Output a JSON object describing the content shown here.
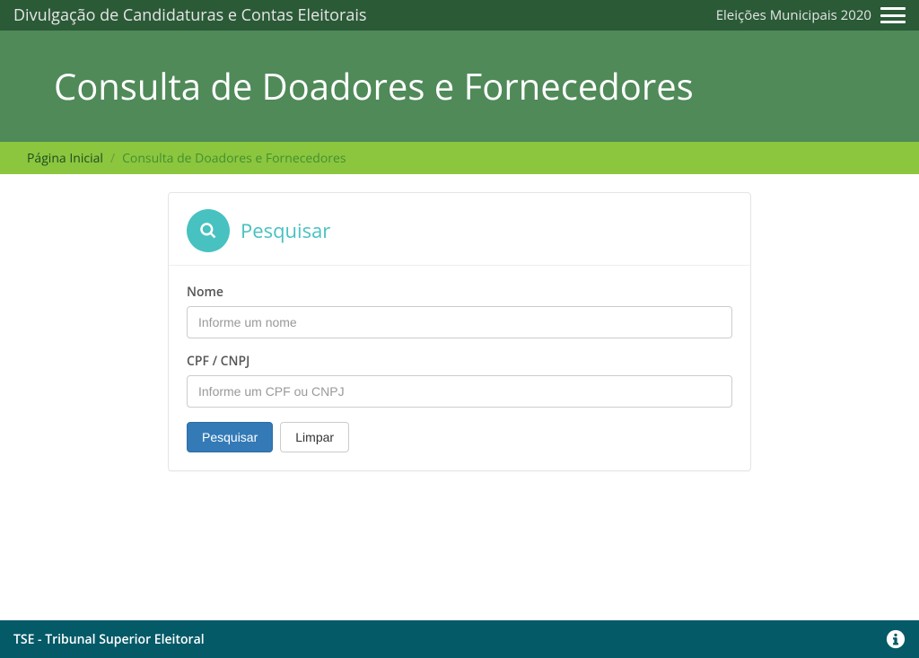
{
  "navbar": {
    "title": "Divulgação de Candidaturas e Contas Eleitorais",
    "election_link": "Eleições Municipais 2020"
  },
  "hero": {
    "title": "Consulta de Doadores e Fornecedores"
  },
  "breadcrumb": {
    "home": "Página Inicial",
    "current": "Consulta de Doadores e Fornecedores"
  },
  "search_card": {
    "header": "Pesquisar",
    "fields": {
      "name_label": "Nome",
      "name_placeholder": "Informe um nome",
      "doc_label": "CPF / CNPJ",
      "doc_placeholder": "Informe um CPF ou CNPJ"
    },
    "buttons": {
      "submit": "Pesquisar",
      "clear": "Limpar"
    }
  },
  "footer": {
    "org": "TSE - Tribunal Superior Eleitoral"
  }
}
